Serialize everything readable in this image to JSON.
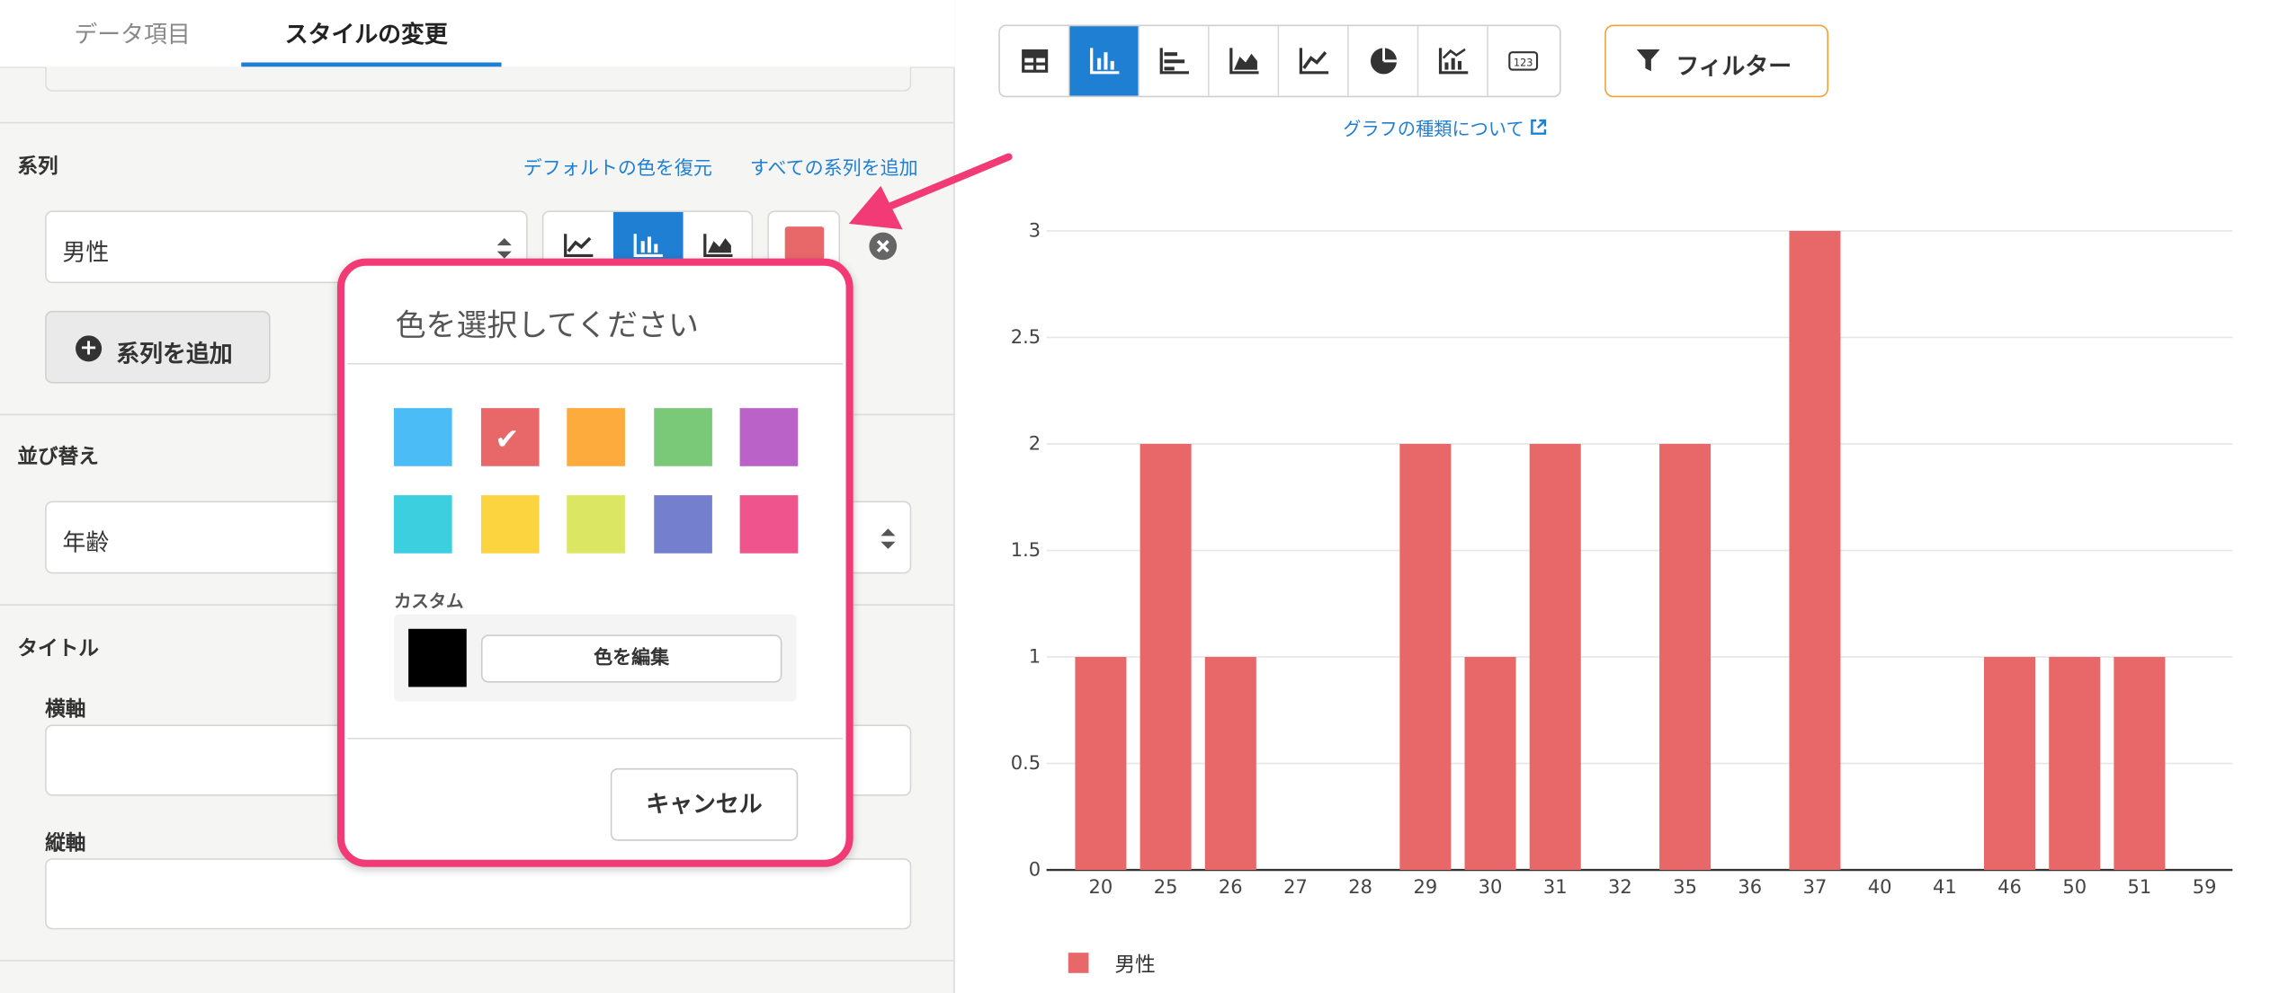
{
  "tabs": [
    {
      "label": "データ項目"
    },
    {
      "label": "スタイルの変更"
    }
  ],
  "series_section": {
    "label": "系列",
    "restore_link": "デフォルトの色を復元",
    "add_all_link": "すべての系列を追加",
    "selected": "男性",
    "add_button": "系列を追加",
    "chart_types": [
      "line-chart-icon",
      "bar-chart-icon",
      "area-chart-icon"
    ],
    "selected_type": "bar-chart-icon",
    "color": "#e8686a"
  },
  "sort_section": {
    "label": "並び替え",
    "selected": "年齢"
  },
  "title_section": {
    "label": "タイトル",
    "x_label": "横軸",
    "y_label": "縦軸",
    "x_value": "",
    "y_value": ""
  },
  "toolbar": {
    "buttons": [
      "table-icon",
      "column-chart-icon",
      "bar-chart-icon",
      "area-chart-icon",
      "line-chart-icon",
      "pie-chart-icon",
      "combo-chart-icon",
      "number-icon"
    ],
    "selected": "column-chart-icon",
    "filter_label": "フィルター",
    "about_link": "グラフの種類について"
  },
  "chart_data": {
    "type": "bar",
    "categories": [
      "20",
      "25",
      "26",
      "27",
      "28",
      "29",
      "30",
      "31",
      "32",
      "35",
      "36",
      "37",
      "40",
      "41",
      "46",
      "50",
      "51",
      "59"
    ],
    "series": [
      {
        "name": "男性",
        "values": [
          1,
          2,
          1,
          0,
          0,
          2,
          1,
          2,
          0,
          2,
          0,
          3,
          0,
          0,
          1,
          1,
          1,
          0
        ],
        "color": "#e8686a"
      }
    ],
    "ylim": [
      0,
      3
    ],
    "yticks": [
      "0",
      "0.5",
      "1",
      "1.5",
      "2",
      "2.5",
      "3"
    ],
    "grid": true,
    "legend": "bottom-left"
  },
  "popup": {
    "title": "色を選択してください",
    "colors": [
      "#4bbcf6",
      "#e8686a",
      "#fdab3d",
      "#79c978",
      "#bb62c9",
      "#3ccfe0",
      "#fcd440",
      "#dbe763",
      "#7480cd",
      "#f0548c"
    ],
    "selected_color": "#e8686a",
    "custom_label": "カスタム",
    "custom_color": "#000000",
    "edit_label": "色を編集",
    "cancel_label": "キャンセル"
  }
}
